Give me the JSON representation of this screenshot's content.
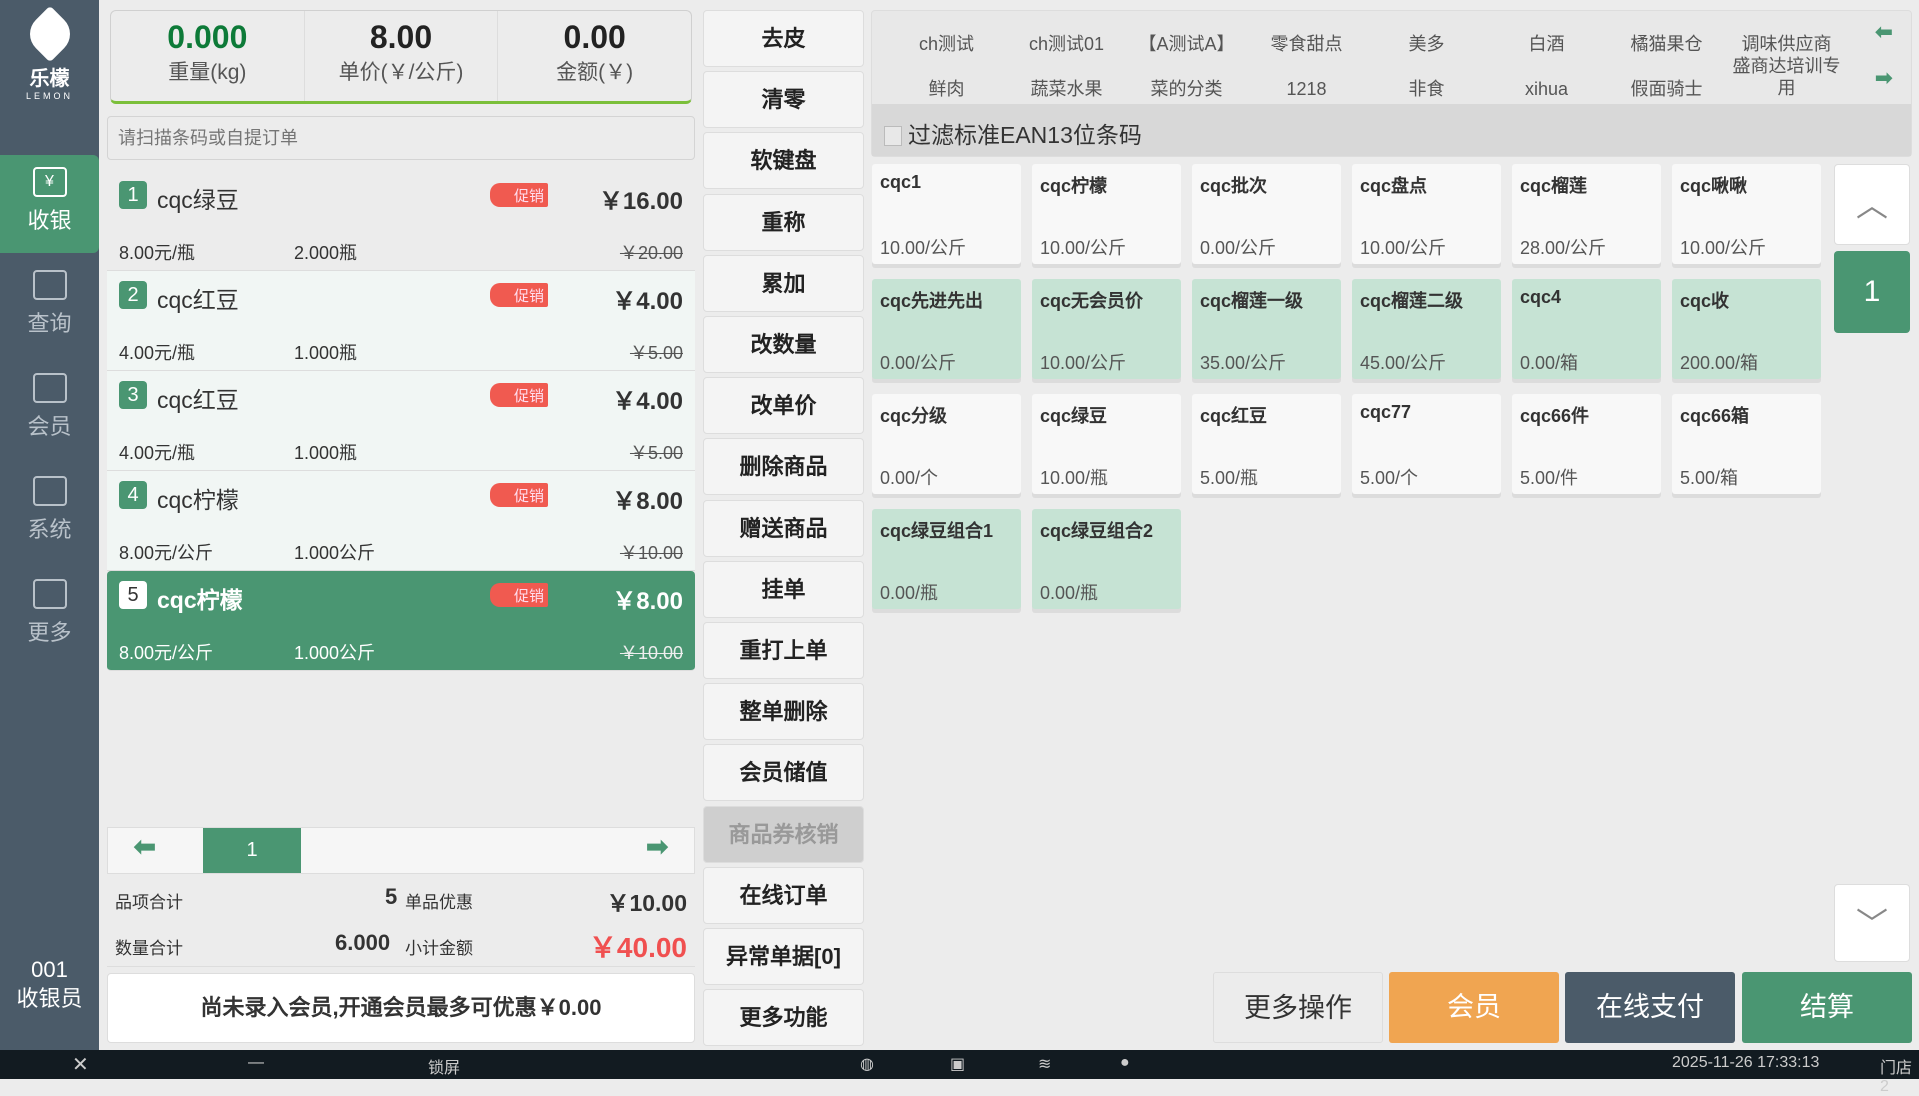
{
  "logo": {
    "name": "乐檬",
    "sub": "LEMON"
  },
  "sidebar": [
    {
      "label": "收银",
      "icon": "¥"
    },
    {
      "label": "查询",
      "icon": ""
    },
    {
      "label": "会员",
      "icon": ""
    },
    {
      "label": "系统",
      "icon": ""
    },
    {
      "label": "更多",
      "icon": ""
    }
  ],
  "cashier": {
    "id": "001",
    "role": "收银员"
  },
  "scale": {
    "weight": "0.000",
    "weight_label": "重量(kg)",
    "price": "8.00",
    "price_label": "单价(￥/公斤)",
    "amount": "0.00",
    "amount_label": "金额(￥)"
  },
  "search": {
    "placeholder": "请扫描条码或自提订单"
  },
  "cart": [
    {
      "no": "1",
      "name": "cqc绿豆",
      "promo": "促销",
      "amount": "￥16.00",
      "unit_price": "8.00元/瓶",
      "qty": "2.000瓶",
      "orig": "￥20.00"
    },
    {
      "no": "2",
      "name": "cqc红豆",
      "promo": "促销",
      "amount": "￥4.00",
      "unit_price": "4.00元/瓶",
      "qty": "1.000瓶",
      "orig": "￥5.00"
    },
    {
      "no": "3",
      "name": "cqc红豆",
      "promo": "促销",
      "amount": "￥4.00",
      "unit_price": "4.00元/瓶",
      "qty": "1.000瓶",
      "orig": "￥5.00"
    },
    {
      "no": "4",
      "name": "cqc柠檬",
      "promo": "促销",
      "amount": "￥8.00",
      "unit_price": "8.00元/公斤",
      "qty": "1.000公斤",
      "orig": "￥10.00"
    },
    {
      "no": "5",
      "name": "cqc柠檬",
      "promo": "促销",
      "amount": "￥8.00",
      "unit_price": "8.00元/公斤",
      "qty": "1.000公斤",
      "orig": "￥10.00"
    }
  ],
  "cart_page": "1",
  "summary": {
    "items_label": "品项合计",
    "items": "5",
    "discount_label": "单品优惠",
    "discount": "￥10.00",
    "qty_label": "数量合计",
    "qty": "6.000",
    "subtotal_label": "小计金额",
    "subtotal": "￥40.00"
  },
  "member_notice": "尚未录入会员,开通会员最多可优惠￥0.00",
  "functions": [
    "去皮",
    "清零",
    "软键盘",
    "重称",
    "累加",
    "改数量",
    "改单价",
    "删除商品",
    "赠送商品",
    "挂单",
    "重打上单",
    "整单删除",
    "会员储值",
    "商品券核销",
    "在线订单",
    "异常单据[0]",
    "更多功能"
  ],
  "categories": [
    [
      "ch测试",
      "ch测试01",
      "【A测试A】",
      "零食甜点",
      "美多",
      "白酒",
      "橘猫果仓",
      "调味供应商"
    ],
    [
      "鲜肉",
      "蔬菜水果",
      "菜的分类",
      "1218",
      "非食",
      "xihua",
      "假面骑士",
      "盛商达培训专用"
    ]
  ],
  "filter_label": "过滤标准EAN13位条码",
  "products": [
    {
      "name": "cqc1",
      "price": "10.00/公斤",
      "g": false
    },
    {
      "name": "cqc柠檬",
      "price": "10.00/公斤",
      "g": false
    },
    {
      "name": "cqc批次",
      "price": "0.00/公斤",
      "g": false
    },
    {
      "name": "cqc盘点",
      "price": "10.00/公斤",
      "g": false
    },
    {
      "name": "cqc榴莲",
      "price": "28.00/公斤",
      "g": false
    },
    {
      "name": "cqc啾啾",
      "price": "10.00/公斤",
      "g": false
    },
    {
      "name": "cqc先进先出",
      "price": "0.00/公斤",
      "g": true
    },
    {
      "name": "cqc无会员价",
      "price": "10.00/公斤",
      "g": true
    },
    {
      "name": "cqc榴莲一级",
      "price": "35.00/公斤",
      "g": true
    },
    {
      "name": "cqc榴莲二级",
      "price": "45.00/公斤",
      "g": true
    },
    {
      "name": "cqc4",
      "price": "0.00/箱",
      "g": true
    },
    {
      "name": "cqc收",
      "price": "200.00/箱",
      "g": true
    },
    {
      "name": "cqc分级",
      "price": "0.00/个",
      "g": false
    },
    {
      "name": "cqc绿豆",
      "price": "10.00/瓶",
      "g": false
    },
    {
      "name": "cqc红豆",
      "price": "5.00/瓶",
      "g": false
    },
    {
      "name": "cqc77",
      "price": "5.00/个",
      "g": false
    },
    {
      "name": "cqc66件",
      "price": "5.00/件",
      "g": false
    },
    {
      "name": "cqc66箱",
      "price": "5.00/箱",
      "g": false
    },
    {
      "name": "cqc绿豆组合1",
      "price": "0.00/瓶",
      "g": true
    },
    {
      "name": "cqc绿豆组合2",
      "price": "0.00/瓶",
      "g": true
    }
  ],
  "product_page": "1",
  "actions": {
    "more": "更多操作",
    "member": "会员",
    "online_pay": "在线支付",
    "checkout": "结算"
  },
  "taskbar": {
    "lock": "锁屏",
    "datetime": "2025-11-26 17:33:13",
    "store": "门店2"
  },
  "colors": {
    "accent": "#4a9672",
    "sidebar": "#4b5b69",
    "member": "#f0a551",
    "subtotal": "#f05050"
  }
}
